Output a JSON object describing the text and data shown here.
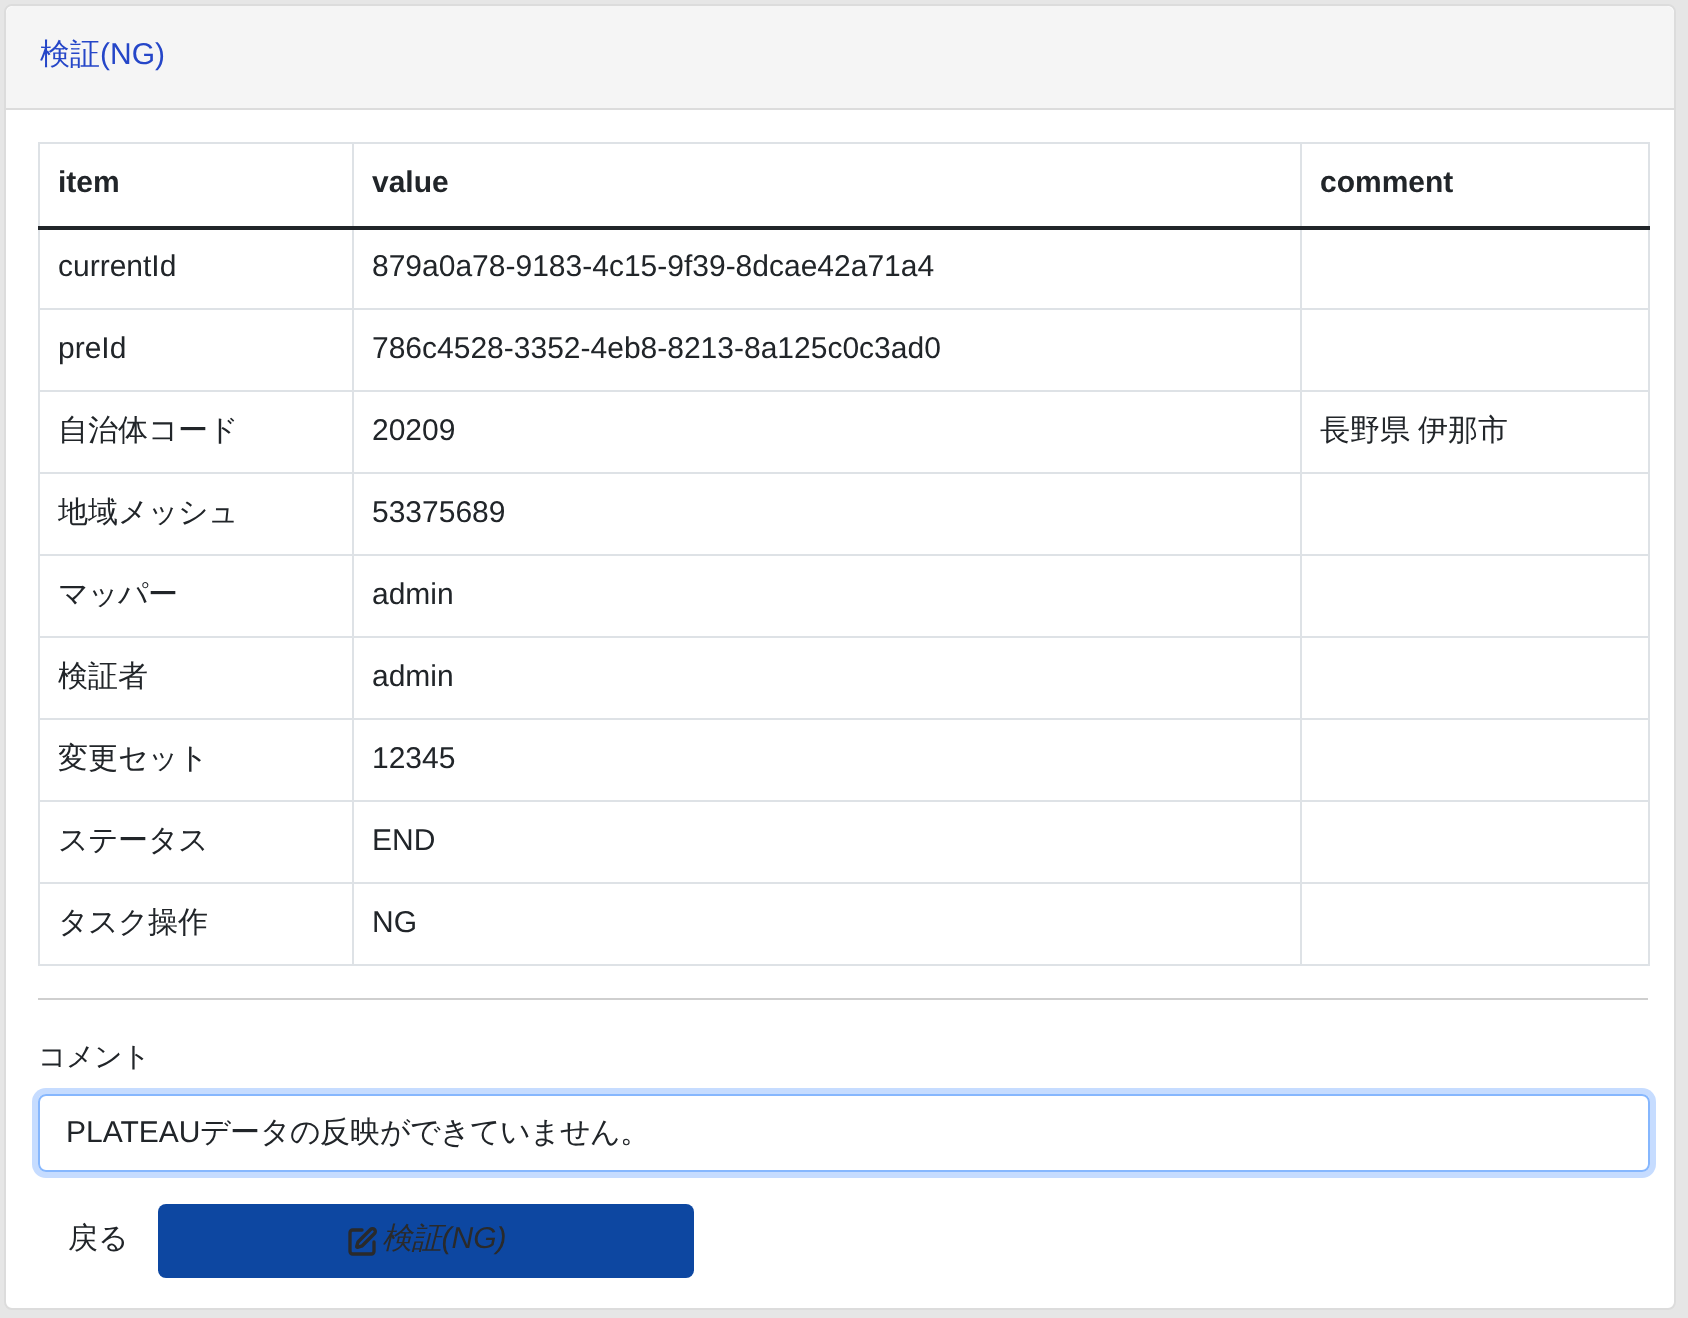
{
  "card": {
    "title": "検証(NG)"
  },
  "table": {
    "columns": [
      "item",
      "value",
      "comment"
    ],
    "rows": [
      {
        "item": "currentId",
        "value": "879a0a78-9183-4c15-9f39-8dcae42a71a4"
      },
      {
        "item": "preId",
        "value": "786c4528-3352-4eb8-8213-8a125c0c3ad0"
      },
      {
        "item": "自治体コード",
        "value": "20209",
        "comment": "長野県 伊那市"
      },
      {
        "item": "地域メッシュ",
        "value": "53375689"
      },
      {
        "item": "マッパー",
        "value": "admin"
      },
      {
        "item": "検証者",
        "value": "admin"
      },
      {
        "item": "変更セット",
        "value": "12345"
      },
      {
        "item": "ステータス",
        "value": "END"
      },
      {
        "item": "タスク操作",
        "value": "NG"
      }
    ]
  },
  "comment_field": {
    "label": "コメント",
    "value": "PLATEAUデータの反映ができていません。",
    "focused": true
  },
  "buttons": [
    {
      "kind": "link",
      "label": "戻る"
    },
    {
      "kind": "primary",
      "label": "検証(NG)"
    }
  ]
}
